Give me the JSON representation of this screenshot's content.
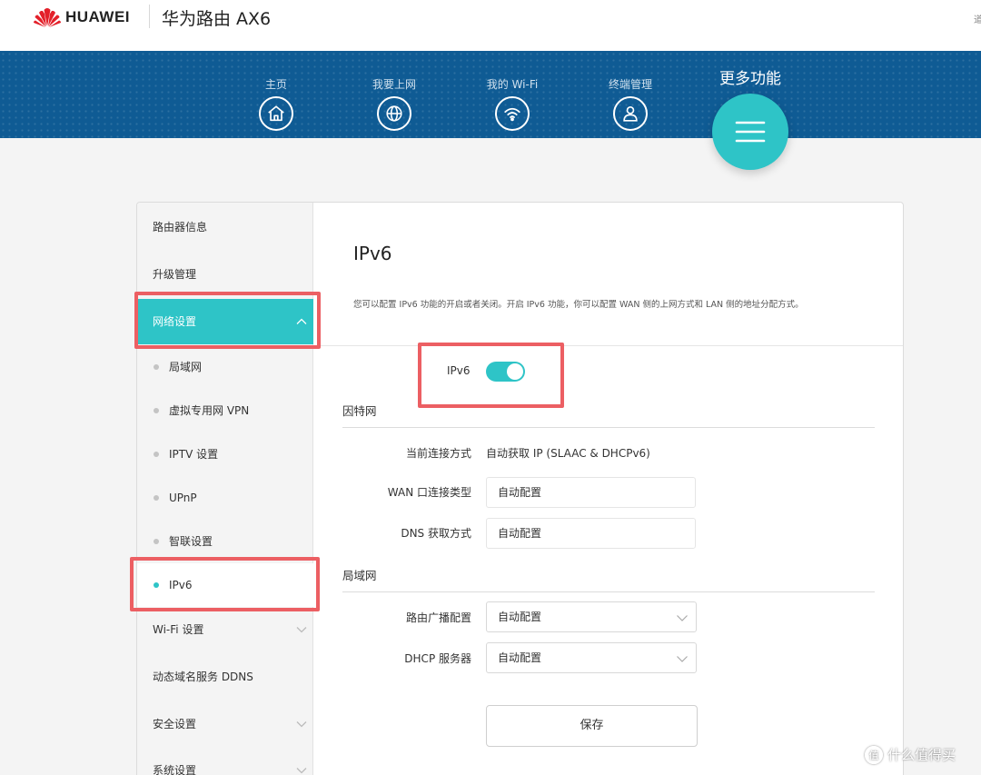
{
  "header": {
    "brand": "HUAWEI",
    "product": "华为路由 AX6",
    "corner_mark": "道"
  },
  "nav": {
    "items": [
      {
        "label": "主页",
        "icon": "home-icon"
      },
      {
        "label": "我要上网",
        "icon": "globe-icon"
      },
      {
        "label": "我的 Wi-Fi",
        "icon": "wifi-icon"
      },
      {
        "label": "终端管理",
        "icon": "user-icon"
      }
    ],
    "more_label": "更多功能",
    "more_icon": "menu-icon"
  },
  "sidebar": {
    "items": [
      {
        "label": "路由器信息"
      },
      {
        "label": "升级管理"
      },
      {
        "label": "网络设置"
      },
      {
        "label": "Wi-Fi 设置"
      },
      {
        "label": "动态域名服务 DDNS"
      },
      {
        "label": "安全设置"
      },
      {
        "label": "系统设置"
      }
    ],
    "sub_items": [
      {
        "label": "局域网"
      },
      {
        "label": "虚拟专用网 VPN"
      },
      {
        "label": "IPTV 设置"
      },
      {
        "label": "UPnP"
      },
      {
        "label": "智联设置"
      },
      {
        "label": "IPv6"
      }
    ]
  },
  "content": {
    "title": "IPv6",
    "description": "您可以配置 IPv6 功能的开启或者关闭。开启 IPv6 功能，你可以配置 WAN 侧的上网方式和 LAN 侧的地址分配方式。",
    "toggle_label": "IPv6",
    "toggle_on": true,
    "internet_section": "因特网",
    "fields": {
      "conn_mode_label": "当前连接方式",
      "conn_mode_value": "自动获取 IP (SLAAC & DHCPv6)",
      "wan_type_label": "WAN 口连接类型",
      "wan_type_value": "自动配置",
      "dns_label": "DNS 获取方式",
      "dns_value": "自动配置"
    },
    "lan_section": "局域网",
    "lan_fields": {
      "ra_label": "路由广播配置",
      "ra_value": "自动配置",
      "dhcp_label": "DHCP 服务器",
      "dhcp_value": "自动配置"
    },
    "save_label": "保存"
  },
  "watermark": {
    "icon_text": "值",
    "text": "什么值得买"
  },
  "colors": {
    "accent": "#2ec4c7",
    "nav_bg": "#0f5b94",
    "highlight": "#ec5f63"
  }
}
